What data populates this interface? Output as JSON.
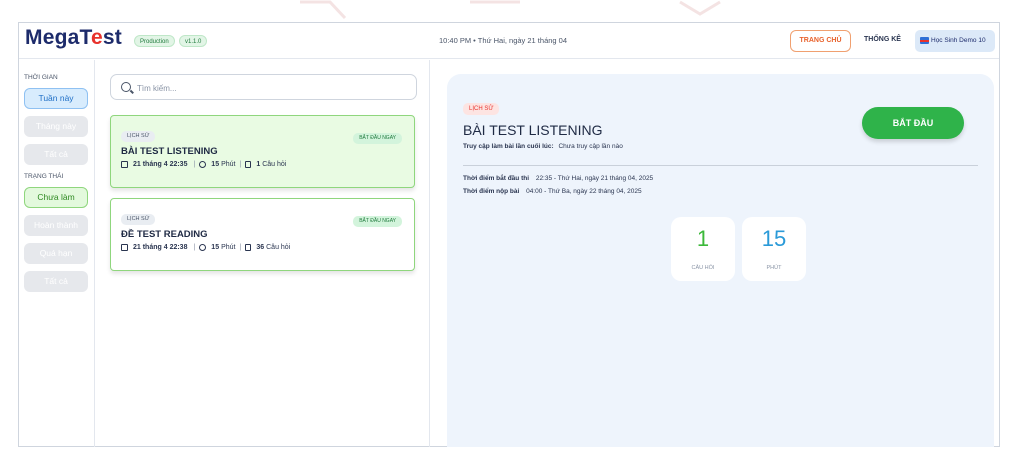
{
  "header": {
    "logo_main": "MegaT",
    "logo_accent": "e",
    "logo_tail": "st",
    "env_badge": "Production",
    "version_badge": "v1.1.0",
    "datetime": "10:40 PM • Thứ Hai, ngày 21 tháng 04",
    "home_button": "TRANG CHỦ",
    "stats_link": "THỐNG KÊ",
    "user_name": "Học Sinh Demo 10"
  },
  "filters": {
    "time_label": "THỜI GIAN",
    "time_options": [
      "Tuần này",
      "Tháng này",
      "Tất cả"
    ],
    "status_label": "TRẠNG THÁI",
    "status_options": [
      "Chưa làm",
      "Hoàn thành",
      "Quá hạn",
      "Tất cả"
    ]
  },
  "search": {
    "placeholder": "Tìm kiếm..."
  },
  "tests": [
    {
      "category": "LỊCH SỬ",
      "badge": "BẮT ĐẦU NGAY",
      "title": "BÀI TEST LISTENING",
      "date": "21 tháng 4 22:35",
      "minutes": "15",
      "minutes_unit": "Phút",
      "questions": "1",
      "questions_unit": "Câu hỏi"
    },
    {
      "category": "LỊCH SỬ",
      "badge": "BẮT ĐẦU NGAY",
      "title": "ĐỀ TEST READING",
      "date": "21 tháng 4 22:38",
      "minutes": "15",
      "minutes_unit": "Phút",
      "questions": "36",
      "questions_unit": "Câu hỏi"
    }
  ],
  "detail": {
    "category": "LỊCH SỬ",
    "title": "BÀI TEST LISTENING",
    "last_access_label": "Truy cập làm bài lần cuối lúc:",
    "last_access_value": "Chưa truy cập lần nào",
    "start_button": "BẮT ĐẦU",
    "start_time_label": "Thời điểm bắt đầu thi",
    "start_time_value": "22:35 - Thứ Hai, ngày 21 tháng 04, 2025",
    "submit_time_label": "Thời điểm nộp bài",
    "submit_time_value": "04:00 - Thứ Ba, ngày 22 tháng 04, 2025",
    "stats": [
      {
        "value": "1",
        "label": "CÂU HỎI",
        "color": "#3cb93a"
      },
      {
        "value": "15",
        "label": "PHÚT",
        "color": "#2a9ad8"
      }
    ]
  },
  "colors": {
    "brand": "#1d2b6b",
    "accent": "#e8322c",
    "start_green": "#2fb34a",
    "home_orange": "#e8622c"
  }
}
